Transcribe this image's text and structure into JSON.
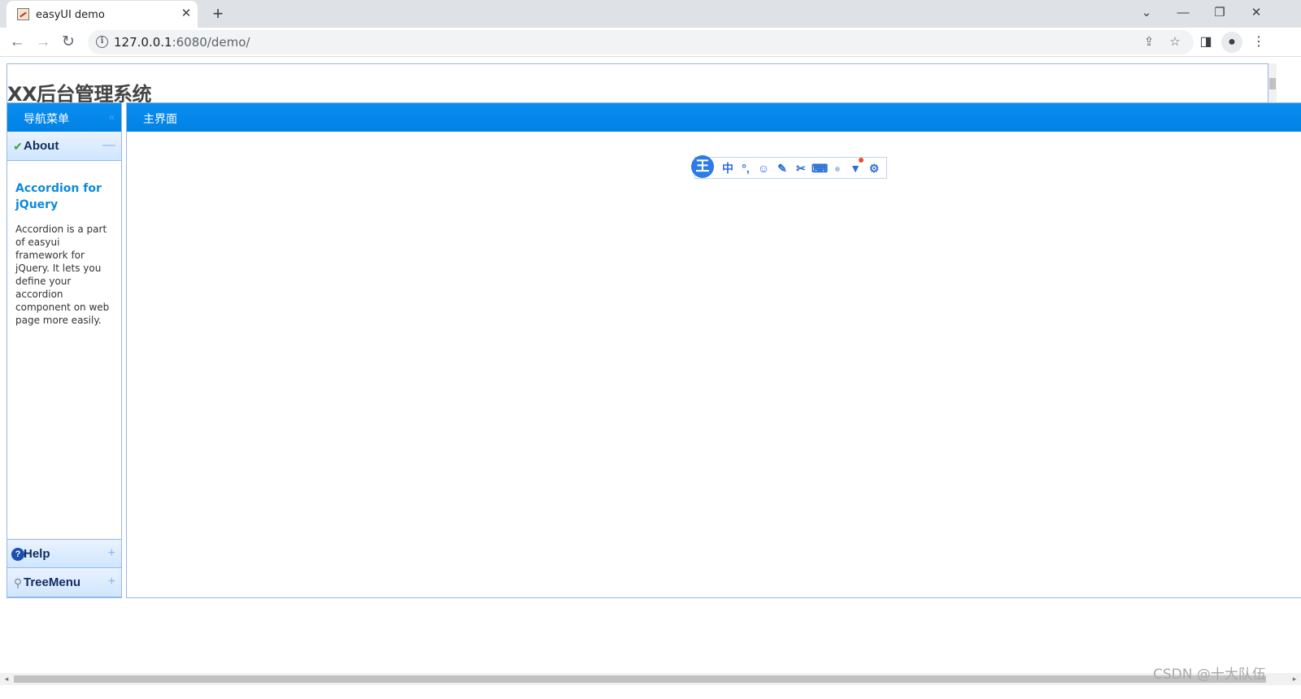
{
  "browser": {
    "tab_title": "easyUI demo",
    "tab_close": "✕",
    "new_tab": "+",
    "url_host": "127.0.0.1",
    "url_path": ":6080/demo/",
    "info_icon": "i"
  },
  "page": {
    "title": "XX后台管理系统"
  },
  "west": {
    "title": "导航菜单",
    "collapse_glyph": "«"
  },
  "accordion": [
    {
      "title": "About",
      "icon": "check-icon",
      "tool": "—"
    },
    {
      "title": "Help",
      "icon": "help-icon",
      "tool": "+"
    },
    {
      "title": "TreeMenu",
      "icon": "search-icon",
      "tool": "+"
    }
  ],
  "about": {
    "heading": "Accordion for jQuery",
    "text": "Accordion is a part of easyui framework for jQuery. It lets you define your accordion component on web page more easily."
  },
  "center": {
    "title": "主界面"
  },
  "ime": {
    "logo": "王",
    "items": [
      "中",
      "°,",
      "☺",
      "✎",
      "✂",
      "⌨",
      "👤",
      "👕",
      "⚙"
    ]
  },
  "watermark": "CSDN @十大队伍",
  "colors": {
    "header_blue": "#0081e5",
    "border_blue": "#95b8e7",
    "accordion_bg": "#cfe6ff"
  }
}
